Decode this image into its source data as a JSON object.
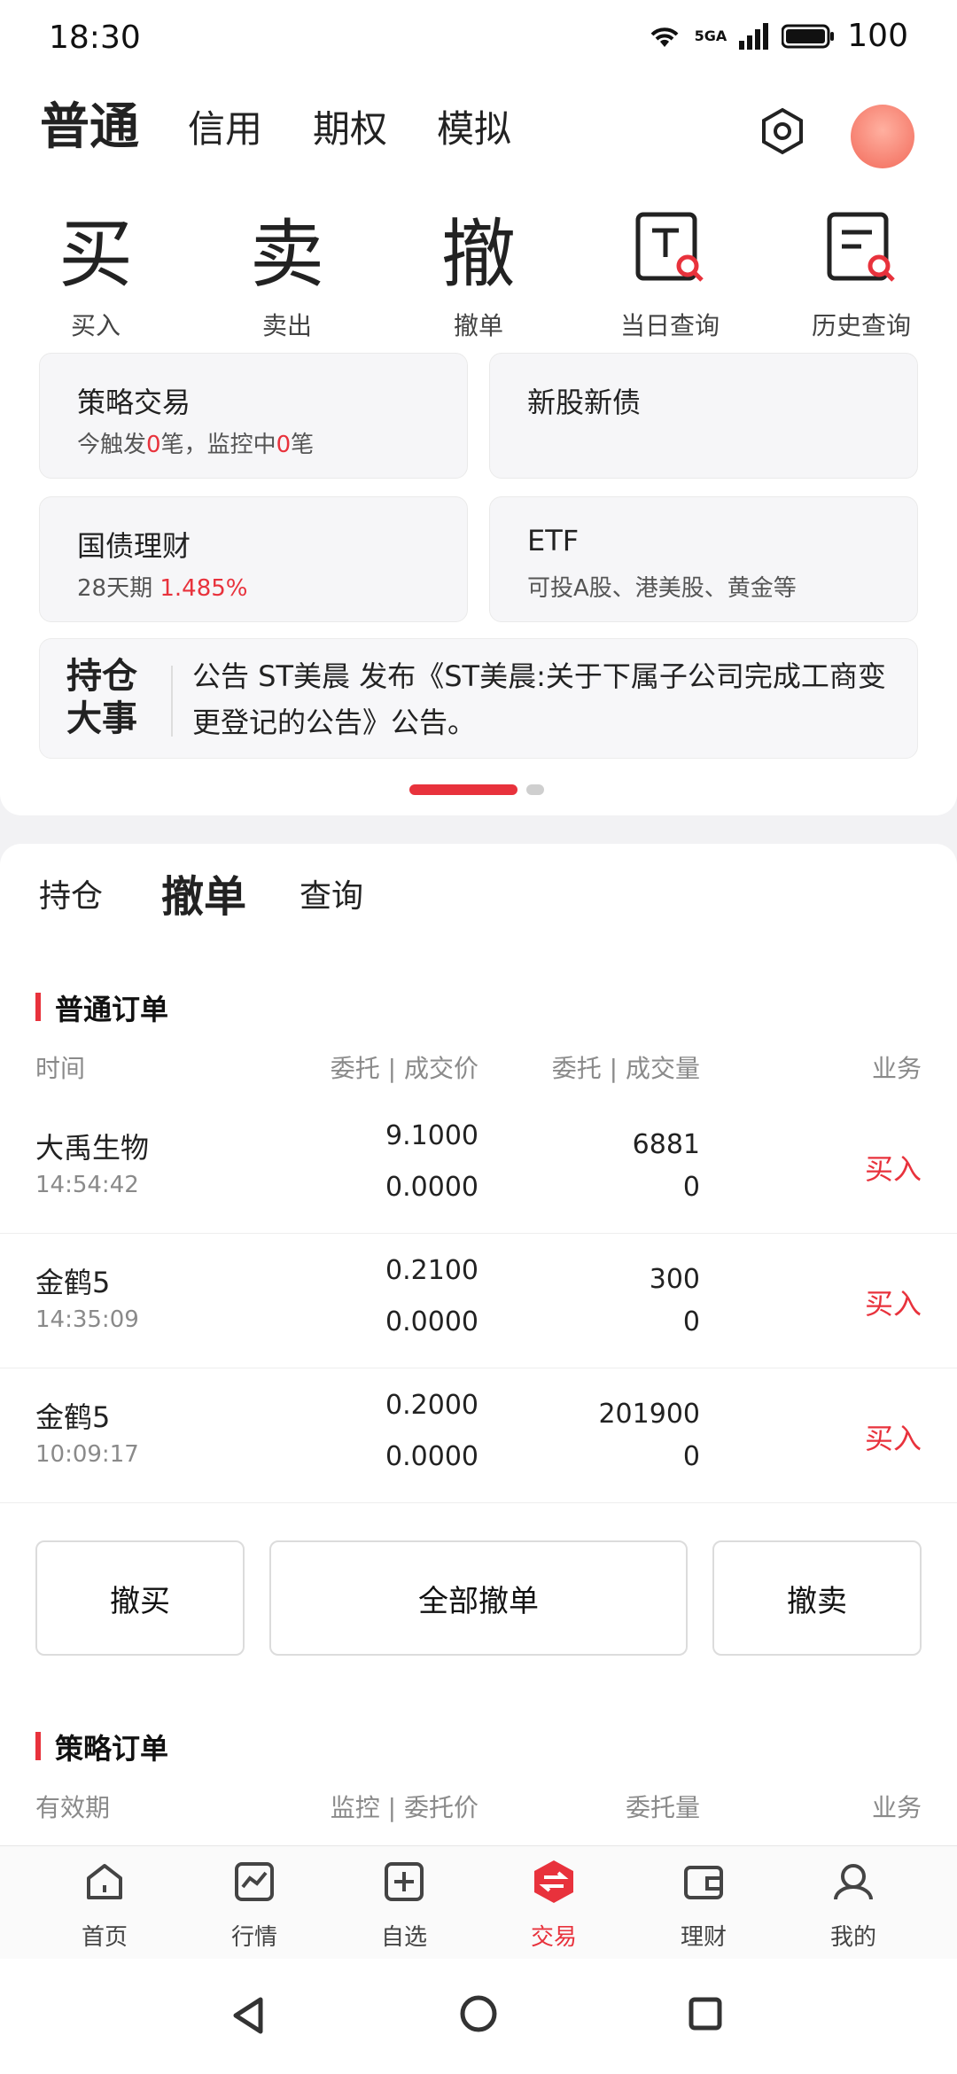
{
  "status_bar": {
    "time": "18:30",
    "network": "5GA",
    "battery": "100"
  },
  "top_tabs": [
    {
      "label": "普通",
      "active": true
    },
    {
      "label": "信用",
      "active": false
    },
    {
      "label": "期权",
      "active": false
    },
    {
      "label": "模拟",
      "active": false
    }
  ],
  "quick_actions": [
    {
      "glyph": "买",
      "label": "买入"
    },
    {
      "glyph": "卖",
      "label": "卖出"
    },
    {
      "glyph": "撤",
      "label": "撤单"
    },
    {
      "label": "当日查询",
      "icon": "search-doc-icon"
    },
    {
      "label": "历史查询",
      "icon": "history-doc-icon"
    }
  ],
  "tiles": {
    "strategy": {
      "title": "策略交易",
      "p1": "今触发",
      "n1": "0",
      "p2": "笔，监控中",
      "n2": "0",
      "p3": "笔"
    },
    "ipo": {
      "title": "新股新债"
    },
    "bond": {
      "title": "国债理财",
      "term": "28天期",
      "rate": "1.485%"
    },
    "etf": {
      "title": "ETF",
      "desc": "可投A股、港美股、黄金等"
    }
  },
  "notice": {
    "badge_line1": "持仓",
    "badge_line2": "大事",
    "text": "公告 ST美晨 发布《ST美晨:关于下属子公司完成工商变更登记的公告》公告。"
  },
  "sub_tabs": [
    {
      "label": "持仓",
      "active": false
    },
    {
      "label": "撤单",
      "active": true
    },
    {
      "label": "查询",
      "active": false
    }
  ],
  "normal_orders": {
    "title": "普通订单",
    "headers": {
      "time": "时间",
      "price": "委托 | 成交价",
      "qty": "委托 | 成交量",
      "biz": "业务"
    },
    "rows": [
      {
        "name": "大禹生物",
        "time": "14:54:42",
        "order_price": "9.1000",
        "deal_price": "0.0000",
        "order_qty": "6881",
        "deal_qty": "0",
        "biz": "买入"
      },
      {
        "name": "金鹤5",
        "time": "14:35:09",
        "order_price": "0.2100",
        "deal_price": "0.0000",
        "order_qty": "300",
        "deal_qty": "0",
        "biz": "买入"
      },
      {
        "name": "金鹤5",
        "time": "10:09:17",
        "order_price": "0.2000",
        "deal_price": "0.0000",
        "order_qty": "201900",
        "deal_qty": "0",
        "biz": "买入"
      }
    ]
  },
  "buttons": {
    "cancel_buy": "撤买",
    "cancel_all": "全部撤单",
    "cancel_sell": "撤卖"
  },
  "strategy_orders": {
    "title": "策略订单",
    "headers": {
      "validity": "有效期",
      "price": "监控 | 委托价",
      "qty": "委托量",
      "biz": "业务"
    }
  },
  "bottom_nav": [
    {
      "label": "首页",
      "icon": "home-icon"
    },
    {
      "label": "行情",
      "icon": "market-chart-icon"
    },
    {
      "label": "自选",
      "icon": "add-watchlist-icon"
    },
    {
      "label": "交易",
      "icon": "trade-icon",
      "active": true
    },
    {
      "label": "理财",
      "icon": "wallet-icon"
    },
    {
      "label": "我的",
      "icon": "profile-icon"
    }
  ],
  "colors": {
    "accent": "#e8323c",
    "muted": "#8a8a8a"
  }
}
